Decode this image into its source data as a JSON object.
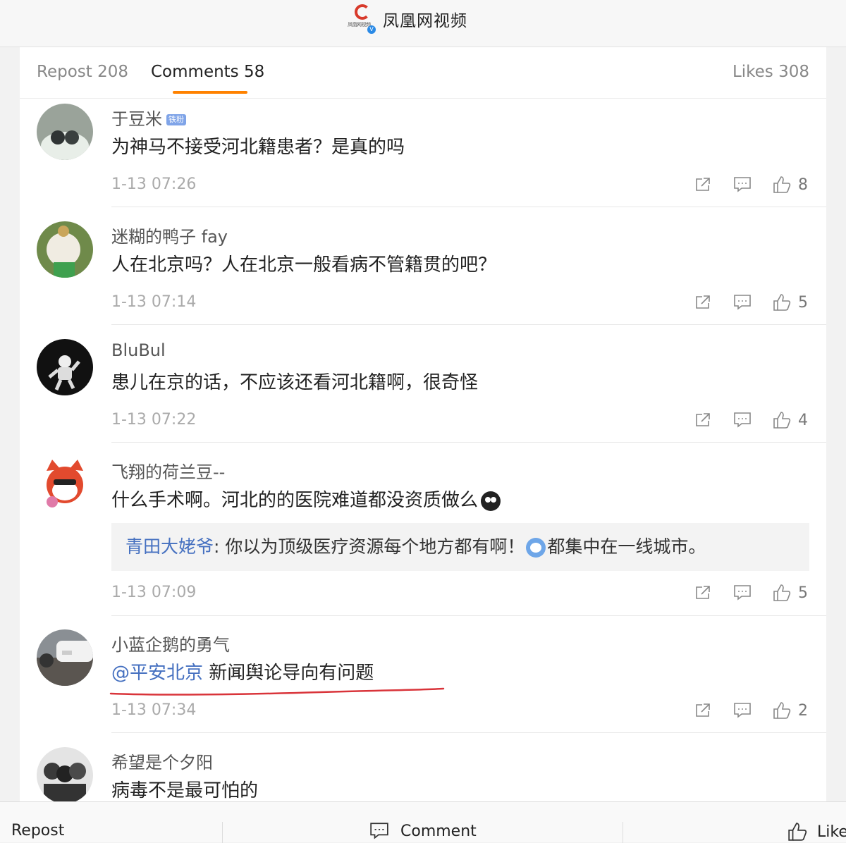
{
  "topbar": {
    "brand_name": "凤凰网视频",
    "logo_caption": "凤凰网视频",
    "logo_badge": "V"
  },
  "tabs": {
    "repost": "Repost 208",
    "comments": "Comments 58",
    "likes": "Likes 308"
  },
  "comments": [
    {
      "name": "于豆米",
      "badge": "铁粉",
      "text": "为神马不接受河北籍患者？是真的吗",
      "time": "1-13 07:26",
      "likes": "8"
    },
    {
      "name": "迷糊的鸭子 fay",
      "text": "人在北京吗？人在北京一般看病不管籍贯的吧？",
      "time": "1-13 07:14",
      "likes": "5"
    },
    {
      "name": "BluBul",
      "text": "患儿在京的话，不应该还看河北籍啊，很奇怪",
      "time": "1-13 07:22",
      "likes": "4"
    },
    {
      "name": "飞翔的荷兰豆--",
      "text": "什么手术啊。河北的的医院难道都没资质做么",
      "reply_user": "青田大姥爷",
      "reply_sep": ": ",
      "reply_text_a": "你以为顶级医疗资源每个地方都有啊！",
      "reply_text_b": "都集中在一线城市。",
      "time": "1-13 07:09",
      "likes": "5"
    },
    {
      "name": "小蓝企鹅的勇气",
      "mention": "@平安北京",
      "text": " 新闻舆论导向有问题",
      "time": "1-13 07:34",
      "likes": "2"
    },
    {
      "name": "希望是个夕阳",
      "text": "病毒不是最可怕的"
    }
  ],
  "bottombar": {
    "repost": "Repost",
    "comment": "Comment",
    "like": "Like"
  },
  "colors": {
    "accent": "#ff8200",
    "mention": "#4570c0",
    "annotation": "#d9343a"
  }
}
